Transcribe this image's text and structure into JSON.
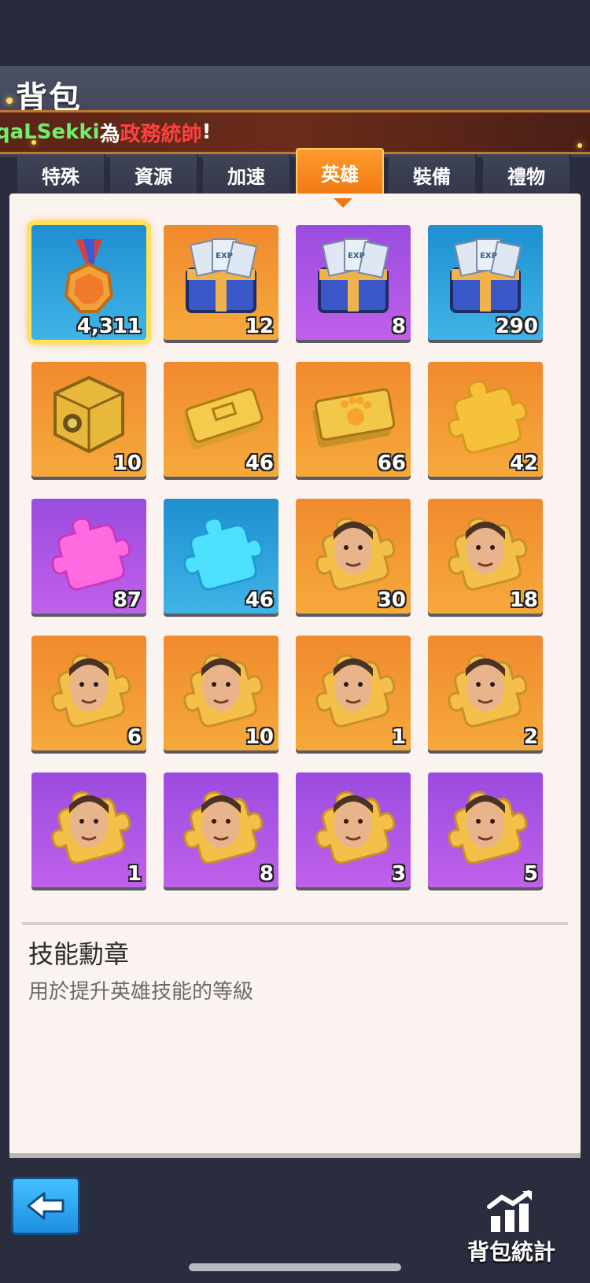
{
  "header": {
    "title": "背包",
    "marquee": {
      "player": "qaLSekki",
      "connector": "為",
      "role": "政務統帥",
      "suffix": "!"
    }
  },
  "tabs": [
    {
      "label": "特殊",
      "active": false
    },
    {
      "label": "資源",
      "active": false
    },
    {
      "label": "加速",
      "active": false
    },
    {
      "label": "英雄",
      "active": true
    },
    {
      "label": "裝備",
      "active": false
    },
    {
      "label": "禮物",
      "active": false
    }
  ],
  "items": [
    {
      "icon": "skill-medal-icon",
      "bg": "blue",
      "count": "4,311",
      "selected": true
    },
    {
      "icon": "exp-crate-icon",
      "bg": "orange",
      "count": "12"
    },
    {
      "icon": "exp-crate-icon",
      "bg": "purple",
      "count": "8"
    },
    {
      "icon": "exp-crate-icon",
      "bg": "blue",
      "count": "290"
    },
    {
      "icon": "gold-cube-icon",
      "bg": "orange",
      "count": "10"
    },
    {
      "icon": "gold-ticket-icon",
      "bg": "orange",
      "count": "46"
    },
    {
      "icon": "paw-ticket-icon",
      "bg": "orange",
      "count": "66"
    },
    {
      "icon": "gold-puzzle-icon",
      "bg": "orange",
      "count": "42"
    },
    {
      "icon": "pink-puzzle-icon",
      "bg": "purple",
      "count": "87"
    },
    {
      "icon": "blue-puzzle-icon",
      "bg": "blue",
      "count": "46"
    },
    {
      "icon": "hero-fragment-icon",
      "bg": "orange",
      "count": "30"
    },
    {
      "icon": "hero-fragment-icon",
      "bg": "orange",
      "count": "18"
    },
    {
      "icon": "hero-fragment-icon",
      "bg": "orange",
      "count": "6"
    },
    {
      "icon": "hero-fragment-icon",
      "bg": "orange",
      "count": "10"
    },
    {
      "icon": "hero-fragment-icon",
      "bg": "orange",
      "count": "1"
    },
    {
      "icon": "hero-fragment-icon",
      "bg": "orange",
      "count": "2"
    },
    {
      "icon": "hero-fragment-icon",
      "bg": "purple",
      "count": "1"
    },
    {
      "icon": "hero-fragment-icon",
      "bg": "purple",
      "count": "8"
    },
    {
      "icon": "hero-fragment-icon",
      "bg": "purple",
      "count": "3"
    },
    {
      "icon": "hero-fragment-icon",
      "bg": "purple",
      "count": "5"
    }
  ],
  "detail": {
    "name": "技能勳章",
    "description": "用於提升英雄技能的等級"
  },
  "footer": {
    "stats_label": "背包統計"
  },
  "colors": {
    "tab_active": "#f07812",
    "panel_bg": "#fbf3ef",
    "player_name": "#6ef06a",
    "role_text": "#ff4141"
  }
}
